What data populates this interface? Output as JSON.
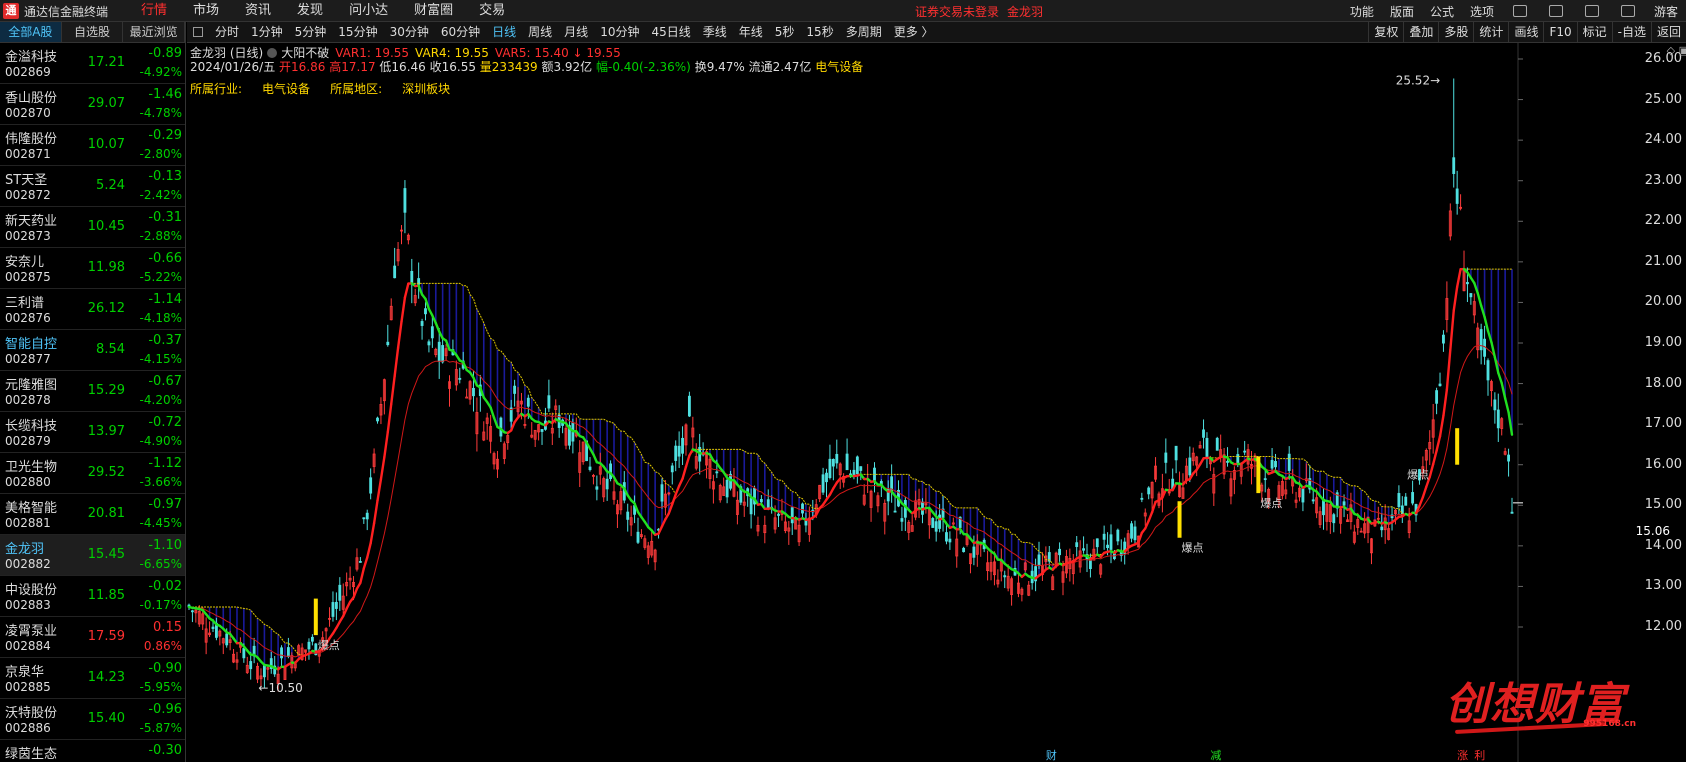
{
  "topbar": {
    "app_title": "通达信金融终端",
    "menu": [
      "行情",
      "市场",
      "资讯",
      "发现",
      "问小达",
      "财富圈",
      "交易"
    ],
    "active_menu": "行情",
    "notice_status": "证券交易未登录",
    "notice_stock": "金龙羽",
    "right_menu": [
      "功能",
      "版面",
      "公式",
      "选项"
    ],
    "guest": "游客"
  },
  "left_tabs": [
    "全部A股",
    "自选股",
    "最近浏览"
  ],
  "stocks": [
    {
      "name": "金溢科技",
      "code": "002869",
      "price": "17.21",
      "change": "-0.89",
      "pct": "-4.92%",
      "dir": "down"
    },
    {
      "name": "香山股份",
      "code": "002870",
      "price": "29.07",
      "change": "-1.46",
      "pct": "-4.78%",
      "dir": "down"
    },
    {
      "name": "伟隆股份",
      "code": "002871",
      "price": "10.07",
      "change": "-0.29",
      "pct": "-2.80%",
      "dir": "down"
    },
    {
      "name": "ST天圣",
      "code": "002872",
      "price": "5.24",
      "change": "-0.13",
      "pct": "-2.42%",
      "dir": "down"
    },
    {
      "name": "新天药业",
      "code": "002873",
      "price": "10.45",
      "change": "-0.31",
      "pct": "-2.88%",
      "dir": "down"
    },
    {
      "name": "安奈儿",
      "code": "002875",
      "price": "11.98",
      "change": "-0.66",
      "pct": "-5.22%",
      "dir": "down"
    },
    {
      "name": "三利谱",
      "code": "002876",
      "price": "26.12",
      "change": "-1.14",
      "pct": "-4.18%",
      "dir": "down"
    },
    {
      "name": "智能自控",
      "code": "002877",
      "price": "8.54",
      "change": "-0.37",
      "pct": "-4.15%",
      "dir": "down",
      "highlight": true
    },
    {
      "name": "元隆雅图",
      "code": "002878",
      "price": "15.29",
      "change": "-0.67",
      "pct": "-4.20%",
      "dir": "down"
    },
    {
      "name": "长缆科技",
      "code": "002879",
      "price": "13.97",
      "change": "-0.72",
      "pct": "-4.90%",
      "dir": "down"
    },
    {
      "name": "卫光生物",
      "code": "002880",
      "price": "29.52",
      "change": "-1.12",
      "pct": "-3.66%",
      "dir": "down"
    },
    {
      "name": "美格智能",
      "code": "002881",
      "price": "20.81",
      "change": "-0.97",
      "pct": "-4.45%",
      "dir": "down"
    },
    {
      "name": "金龙羽",
      "code": "002882",
      "price": "15.45",
      "change": "-1.10",
      "pct": "-6.65%",
      "dir": "down",
      "selected": true,
      "highlight": true
    },
    {
      "name": "中设股份",
      "code": "002883",
      "price": "11.85",
      "change": "-0.02",
      "pct": "-0.17%",
      "dir": "down"
    },
    {
      "name": "凌霄泵业",
      "code": "002884",
      "price": "17.59",
      "change": "0.15",
      "pct": "0.86%",
      "dir": "up"
    },
    {
      "name": "京泉华",
      "code": "002885",
      "price": "14.23",
      "change": "-0.90",
      "pct": "-5.95%",
      "dir": "down"
    },
    {
      "name": "沃特股份",
      "code": "002886",
      "price": "15.40",
      "change": "-0.96",
      "pct": "-5.87%",
      "dir": "down"
    },
    {
      "name": "绿茵生态",
      "code": "",
      "price": "",
      "change": "-0.30",
      "pct": "",
      "dir": "down"
    }
  ],
  "periods": [
    "分时",
    "1分钟",
    "5分钟",
    "15分钟",
    "30分钟",
    "60分钟",
    "日线",
    "周线",
    "月线",
    "10分钟",
    "45日线",
    "季线",
    "年线",
    "5秒",
    "15秒",
    "多周期",
    "更多 〉"
  ],
  "active_period": "日线",
  "tools": [
    "复权",
    "叠加",
    "多股",
    "统计",
    "画线",
    "F10",
    "标记",
    "-自选",
    "返回"
  ],
  "info": {
    "title": "金龙羽 (日线)",
    "indicator": "大阳不破",
    "var1": "VAR1: 19.55",
    "var4": "VAR4: 19.55",
    "var5": "VAR5: 15.40 ↓ 19.55",
    "date": "2024/01/26/五",
    "open": "开16.86",
    "high": "高17.17",
    "low": "低16.46",
    "close": "收16.55",
    "volume": "量233439",
    "amount": "额3.92亿",
    "range": "幅-0.40(-2.36%)",
    "turnover": "换9.47%",
    "float": "流通2.47亿",
    "sector": "电气设备",
    "industry_label": "所属行业:",
    "industry_value": "电气设备",
    "region_label": "所属地区:",
    "region_value": "深圳板块"
  },
  "chart_data": {
    "type": "candlestick",
    "yticks": [
      12.0,
      13.0,
      14.0,
      15.0,
      16.0,
      17.0,
      18.0,
      19.0,
      20.0,
      21.0,
      22.0,
      23.0,
      24.0,
      25.0,
      26.0
    ],
    "ylim": [
      11.3,
      26.2
    ],
    "current_price": "15.06",
    "high_label": "25.52",
    "low_label": "10.50",
    "signal_label": "爆点",
    "bottom_labels": [
      "财",
      "减",
      "涨",
      "利"
    ],
    "key_points": [
      [
        0,
        12.5
      ],
      [
        10,
        11.8
      ],
      [
        18,
        11.1
      ],
      [
        22,
        10.9
      ],
      [
        30,
        11.3
      ],
      [
        38,
        11.6
      ],
      [
        45,
        12.8
      ],
      [
        50,
        13.8
      ],
      [
        54,
        16.0
      ],
      [
        58,
        19.0
      ],
      [
        60,
        21.0
      ],
      [
        63,
        21.8
      ],
      [
        66,
        20.4
      ],
      [
        70,
        18.9
      ],
      [
        75,
        18.5
      ],
      [
        80,
        18.3
      ],
      [
        85,
        17.4
      ],
      [
        90,
        16.5
      ],
      [
        96,
        17.6
      ],
      [
        102,
        16.8
      ],
      [
        108,
        17.2
      ],
      [
        114,
        16.6
      ],
      [
        120,
        15.6
      ],
      [
        126,
        15.0
      ],
      [
        132,
        14.3
      ],
      [
        136,
        14.2
      ],
      [
        140,
        15.5
      ],
      [
        146,
        16.8
      ],
      [
        152,
        16.0
      ],
      [
        158,
        15.3
      ],
      [
        165,
        14.9
      ],
      [
        172,
        14.6
      ],
      [
        178,
        14.3
      ],
      [
        184,
        15.4
      ],
      [
        190,
        16.0
      ],
      [
        196,
        15.6
      ],
      [
        202,
        15.2
      ],
      [
        210,
        14.9
      ],
      [
        218,
        14.6
      ],
      [
        226,
        14.1
      ],
      [
        234,
        13.5
      ],
      [
        240,
        13.2
      ],
      [
        246,
        13.3
      ],
      [
        254,
        13.6
      ],
      [
        262,
        13.7
      ],
      [
        270,
        13.9
      ],
      [
        276,
        14.4
      ],
      [
        282,
        15.6
      ],
      [
        290,
        15.8
      ],
      [
        296,
        16.4
      ],
      [
        302,
        15.9
      ],
      [
        308,
        16.2
      ],
      [
        316,
        15.6
      ],
      [
        324,
        15.4
      ],
      [
        332,
        15.0
      ],
      [
        340,
        14.6
      ],
      [
        346,
        14.3
      ],
      [
        352,
        14.6
      ],
      [
        358,
        15.0
      ],
      [
        362,
        16.5
      ],
      [
        366,
        19.0
      ],
      [
        369,
        23.2
      ],
      [
        370,
        22.6
      ],
      [
        373,
        20.6
      ],
      [
        376,
        19.0
      ],
      [
        379,
        18.0
      ],
      [
        382,
        17.2
      ],
      [
        385,
        16.3
      ],
      [
        386,
        15.1
      ]
    ],
    "n_candles": 387
  }
}
